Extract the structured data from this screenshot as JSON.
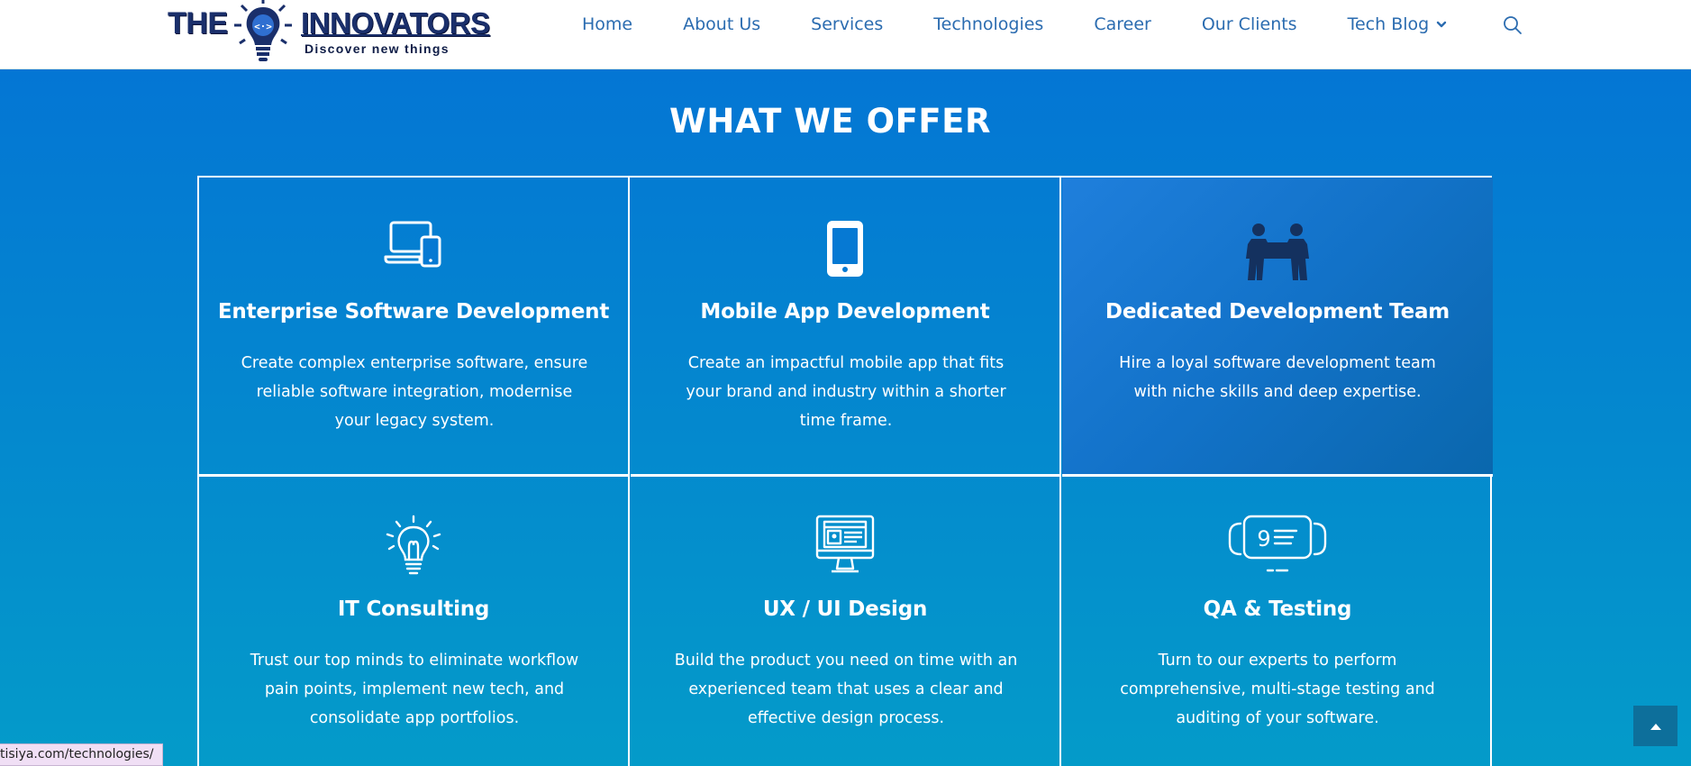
{
  "logo": {
    "brand_left": "THE",
    "brand_right": "INNOVATORS",
    "tagline": "Discover new things"
  },
  "nav": {
    "items": [
      {
        "label": "Home"
      },
      {
        "label": "About Us"
      },
      {
        "label": "Services"
      },
      {
        "label": "Technologies"
      },
      {
        "label": "Career"
      },
      {
        "label": "Our Clients"
      },
      {
        "label": "Tech Blog",
        "has_dropdown": true
      }
    ],
    "search_icon": "search-icon"
  },
  "section": {
    "title": "WHAT WE OFFER",
    "cards": [
      {
        "icon": "devices-icon",
        "title": "Enterprise Software Development",
        "description": "Create complex enterprise software, ensure reliable software integration, modernise your legacy system."
      },
      {
        "icon": "smartphone-icon",
        "title": "Mobile App Development",
        "description": "Create an impactful mobile app that fits your brand and industry within a shorter time frame."
      },
      {
        "icon": "team-icon",
        "title": "Dedicated Development Team",
        "description": "Hire a loyal software development team with niche skills and deep expertise.",
        "highlighted": true
      },
      {
        "icon": "lightbulb-icon",
        "title": "IT Consulting",
        "description": "Trust our top minds to eliminate workflow pain points, implement new tech, and consolidate app portfolios."
      },
      {
        "icon": "monitor-design-icon",
        "title": "UX / UI Design",
        "description": "Build the product you need on time with an experienced team that uses a clear and effective design process."
      },
      {
        "icon": "testing-icon",
        "title": "QA & Testing",
        "description": "Turn to our experts to perform comprehensive, multi-stage testing and auditing of your software."
      }
    ]
  },
  "status_bar": {
    "url": "tisiya.com/technologies/"
  },
  "colors": {
    "nav_link": "#2b6cb0",
    "section_top": "#0476d4",
    "section_bottom": "#049bc9",
    "scroll_top_bg": "#0d6f9b",
    "team_icon": "#14315f"
  }
}
